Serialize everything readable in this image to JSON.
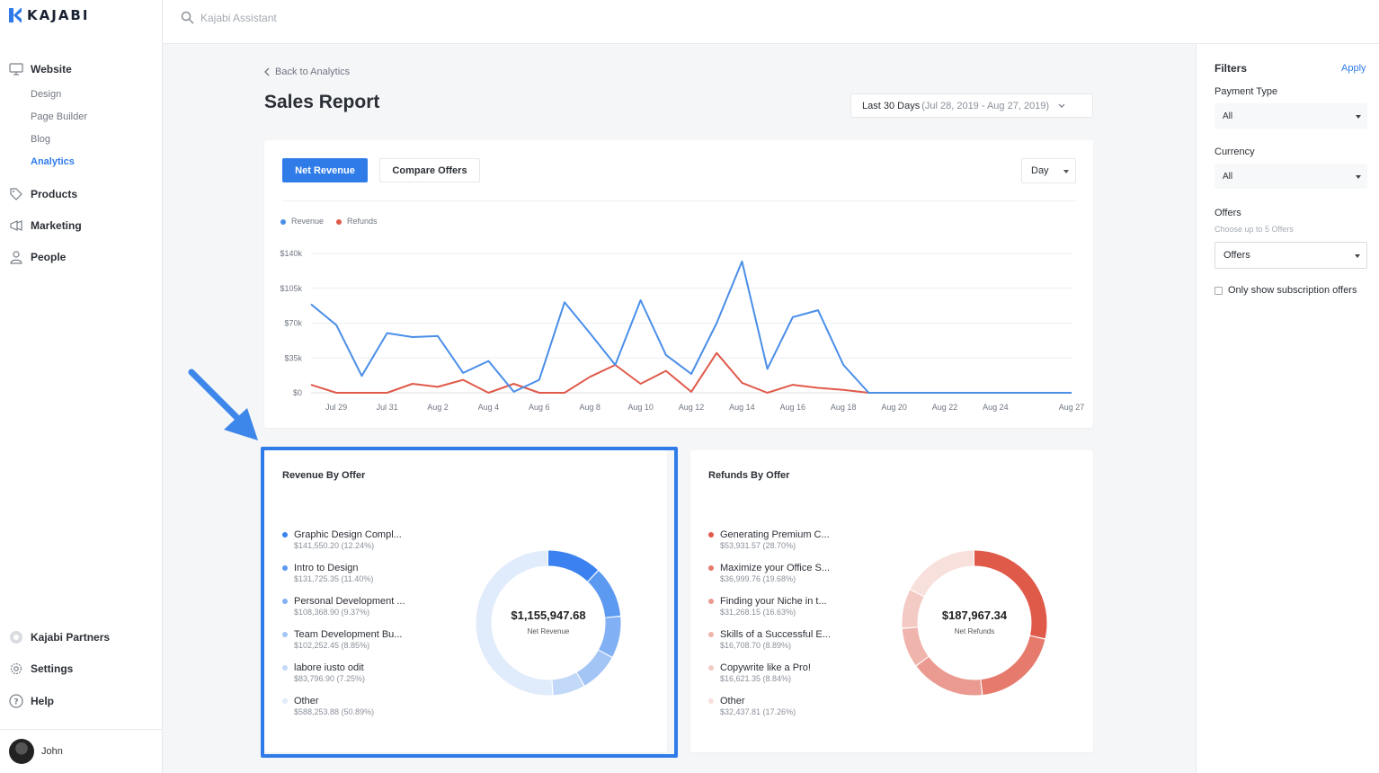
{
  "app": {
    "logo_text": "KAJABI"
  },
  "topbar": {
    "search_placeholder": "Kajabi Assistant"
  },
  "sidebar": {
    "items": [
      {
        "label": "Website",
        "icon": "monitor-icon"
      },
      {
        "label": "Products",
        "icon": "tag-icon"
      },
      {
        "label": "Marketing",
        "icon": "megaphone-icon"
      },
      {
        "label": "People",
        "icon": "person-icon"
      }
    ],
    "website_sub": [
      "Design",
      "Page Builder",
      "Blog",
      "Analytics"
    ],
    "active_sub": "Analytics",
    "bottom": [
      {
        "label": "Kajabi Partners",
        "icon": "partners-icon"
      },
      {
        "label": "Settings",
        "icon": "gear-icon"
      },
      {
        "label": "Help",
        "icon": "help-icon"
      }
    ],
    "user_name": "John"
  },
  "header": {
    "back_label": "Back to Analytics",
    "title": "Sales Report",
    "date_range_label": "Last 30 Days",
    "date_range_detail": "(Jul 28, 2019 - Aug 27, 2019)"
  },
  "chart_panel": {
    "tabs": [
      "Net Revenue",
      "Compare Offers"
    ],
    "active_tab": "Net Revenue",
    "period": "Day"
  },
  "chart_data": {
    "type": "line",
    "x": [
      "Jul 28",
      "Jul 29",
      "Jul 30",
      "Jul 31",
      "Aug 1",
      "Aug 2",
      "Aug 3",
      "Aug 4",
      "Aug 5",
      "Aug 6",
      "Aug 7",
      "Aug 8",
      "Aug 9",
      "Aug 10",
      "Aug 11",
      "Aug 12",
      "Aug 13",
      "Aug 14",
      "Aug 15",
      "Aug 16",
      "Aug 17",
      "Aug 18",
      "Aug 19",
      "Aug 20",
      "Aug 21",
      "Aug 22",
      "Aug 23",
      "Aug 24",
      "Aug 25",
      "Aug 26",
      "Aug 27"
    ],
    "x_tick_labels": [
      "Jul 29",
      "Jul 31",
      "Aug 2",
      "Aug 4",
      "Aug 6",
      "Aug 8",
      "Aug 10",
      "Aug 12",
      "Aug 14",
      "Aug 16",
      "Aug 18",
      "Aug 20",
      "Aug 22",
      "Aug 24",
      "Aug 27"
    ],
    "y_tick_labels": [
      "$0",
      "$35k",
      "$70k",
      "$105k",
      "$140k"
    ],
    "ylim": [
      0,
      140000
    ],
    "series": [
      {
        "name": "Revenue",
        "color": "#4a8ee8",
        "values": [
          89000,
          68000,
          17000,
          60000,
          56000,
          57000,
          20000,
          32000,
          1000,
          13000,
          91000,
          60000,
          28000,
          93000,
          38000,
          19000,
          70000,
          132000,
          24000,
          76000,
          83000,
          28000,
          0,
          0,
          0,
          0,
          0,
          0,
          0,
          0,
          0
        ]
      },
      {
        "name": "Refunds",
        "color": "#e05a4a",
        "values": [
          8000,
          0,
          0,
          0,
          9000,
          6000,
          13000,
          0,
          9000,
          0,
          0,
          16000,
          28000,
          9000,
          22000,
          1000,
          40000,
          10000,
          0,
          8000,
          5000,
          3000,
          0,
          0,
          0,
          0,
          0,
          0,
          0,
          0,
          0
        ]
      }
    ],
    "grid": true,
    "legend": "top-left"
  },
  "revenue_breakdown": {
    "title": "Revenue By Offer",
    "total": "$1,155,947.68",
    "total_label": "Net Revenue",
    "items": [
      {
        "name": "Graphic Design Compl...",
        "detail": "$141,550.20 (12.24%)",
        "pct": 12.24,
        "color": "#3b82f0"
      },
      {
        "name": "Intro to Design",
        "detail": "$131,725.35 (11.40%)",
        "pct": 11.4,
        "color": "#5c99f0"
      },
      {
        "name": "Personal Development ...",
        "detail": "$108,368.90 (9.37%)",
        "pct": 9.37,
        "color": "#82b0f4"
      },
      {
        "name": "Team Development Bu...",
        "detail": "$102,252.45 (8.85%)",
        "pct": 8.85,
        "color": "#a3c5f6"
      },
      {
        "name": "labore iusto odit",
        "detail": "$83,796.90 (7.25%)",
        "pct": 7.25,
        "color": "#c2d8f8"
      },
      {
        "name": "Other",
        "detail": "$588,253.88 (50.89%)",
        "pct": 50.89,
        "color": "#e0ebfb"
      }
    ]
  },
  "refunds_breakdown": {
    "title": "Refunds By Offer",
    "total": "$187,967.34",
    "total_label": "Net Refunds",
    "items": [
      {
        "name": "Generating Premium C...",
        "detail": "$53,931.57 (28.70%)",
        "pct": 28.7,
        "color": "#e05a4a"
      },
      {
        "name": "Maximize your Office S...",
        "detail": "$36,999.76 (19.68%)",
        "pct": 19.68,
        "color": "#e57a6d"
      },
      {
        "name": "Finding your Niche in t...",
        "detail": "$31,268.15 (16.63%)",
        "pct": 16.63,
        "color": "#ea9a90"
      },
      {
        "name": "Skills of a Successful E...",
        "detail": "$16,708.70 (8.89%)",
        "pct": 8.89,
        "color": "#efb4ac"
      },
      {
        "name": "Copywrite like a Pro!",
        "detail": "$16,621.35 (8.84%)",
        "pct": 8.84,
        "color": "#f3cac4"
      },
      {
        "name": "Other",
        "detail": "$32,437.81 (17.26%)",
        "pct": 17.26,
        "color": "#f8e0dc"
      }
    ]
  },
  "filters": {
    "title": "Filters",
    "apply_label": "Apply",
    "payment_type_label": "Payment Type",
    "payment_type_value": "All",
    "currency_label": "Currency",
    "currency_value": "All",
    "offers_label": "Offers",
    "offers_hint": "Choose up to 5 Offers",
    "offers_value": "Offers",
    "subscription_only_label": "Only show subscription offers"
  },
  "colors": {
    "accent": "#2f7ce8"
  }
}
